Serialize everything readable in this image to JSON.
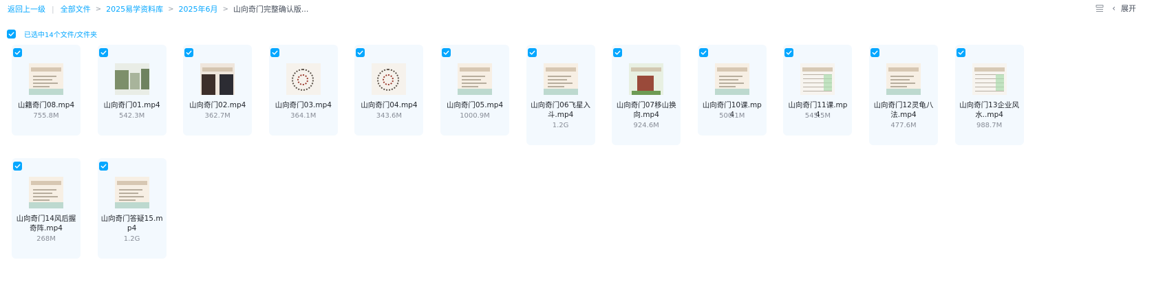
{
  "breadcrumb": {
    "back": "返回上一级",
    "items": [
      "全部文件",
      "2025易学资料库",
      "2025年6月"
    ],
    "current": "山向奇门完整确认版..."
  },
  "toolbar": {
    "expand_label": "展开",
    "list_icon": "list-view-icon",
    "collapse_icon": "chevron-left-icon"
  },
  "selection": {
    "summary": "已选中14个文件/文件夹"
  },
  "colors": {
    "accent": "#06a7ff",
    "card_bg": "#f3f9fe"
  },
  "files": [
    {
      "name": "山籍奇门08.mp4",
      "size": "755.8M",
      "thumb": "title-slide"
    },
    {
      "name": "山向奇门01.mp4",
      "size": "542.3M",
      "thumb": "photo-landscape"
    },
    {
      "name": "山向奇门02.mp4",
      "size": "362.7M",
      "thumb": "photo-people"
    },
    {
      "name": "山向奇门03.mp4",
      "size": "364.1M",
      "thumb": "luopan-diagram"
    },
    {
      "name": "山向奇门04.mp4",
      "size": "343.6M",
      "thumb": "luopan-diagram"
    },
    {
      "name": "山向奇门05.mp4",
      "size": "1000.9M",
      "thumb": "text-slide"
    },
    {
      "name": "山向奇门06飞星入斗.mp4",
      "size": "1.2G",
      "thumb": "title-slide"
    },
    {
      "name": "山向奇门07移山换向.mp4",
      "size": "924.6M",
      "thumb": "house-image"
    },
    {
      "name": "山向奇门10课.mp4",
      "size": "500.1M",
      "thumb": "text-slide"
    },
    {
      "name": "山向奇门11课.mp4",
      "size": "545.5M",
      "thumb": "table-slide"
    },
    {
      "name": "山向奇门12灵龟八法.mp4",
      "size": "477.6M",
      "thumb": "text-slide"
    },
    {
      "name": "山向奇门13企业风水..mp4",
      "size": "988.7M",
      "thumb": "table-slide"
    },
    {
      "name": "山向奇门14风后握奇阵.mp4",
      "size": "268M",
      "thumb": "text-slide"
    },
    {
      "name": "山向奇门答疑15.mp4",
      "size": "1.2G",
      "thumb": "text-slide"
    }
  ]
}
